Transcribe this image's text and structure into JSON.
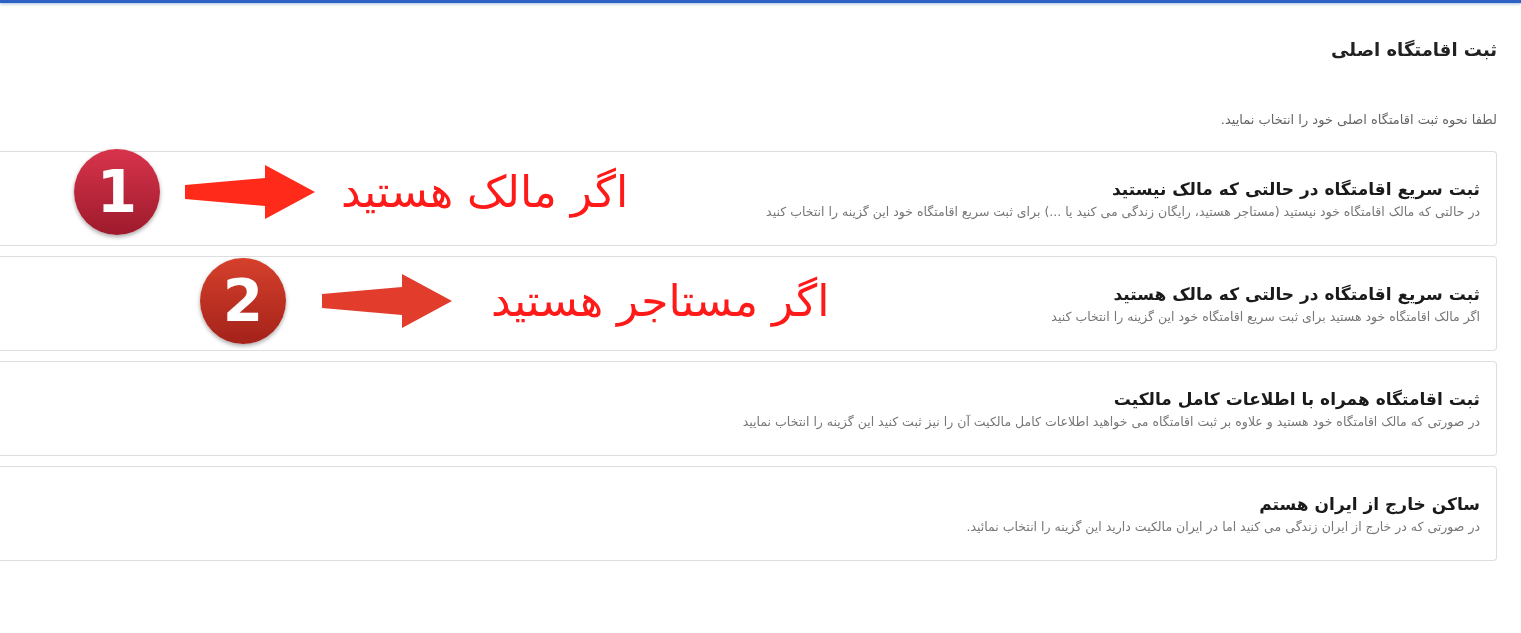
{
  "header": {
    "title": "ثبت اقامتگاه اصلی",
    "subtitle": "لطفا نحوه ثبت اقامتگاه اصلی خود را انتخاب نمایید."
  },
  "options": [
    {
      "title": "ثبت سریع اقامتگاه در حالتی که مالک نیستید",
      "description": "در حالتی که مالک اقامتگاه خود نیستید (مستاجر هستید، رایگان زندگی می کنید یا ...) برای ثبت سریع اقامتگاه خود این گزینه را انتخاب کنید",
      "annotation": {
        "number": "1",
        "text": "اگر مالک هستید"
      }
    },
    {
      "title": "ثبت سریع اقامتگاه در حالتی که مالک هستید",
      "description": "اگر مالک اقامتگاه خود هستید برای ثبت سریع اقامتگاه خود این گزینه را انتخاب کنید",
      "annotation": {
        "number": "2",
        "text": "اگر مستاجر هستید"
      }
    },
    {
      "title": "ثبت اقامتگاه همراه با اطلاعات کامل مالکیت",
      "description": "در صورتی که مالک اقامتگاه خود هستید و علاوه بر ثبت اقامتگاه می خواهید اطلاعات کامل مالکیت آن را نیز ثبت کنید این گزینه را انتخاب نمایید"
    },
    {
      "title": "ساکن خارج از ایران هستم",
      "description": "در صورتی که در خارج از ایران زندگی می کنید اما در ایران مالکیت دارید این گزینه را انتخاب نمائید."
    }
  ]
}
